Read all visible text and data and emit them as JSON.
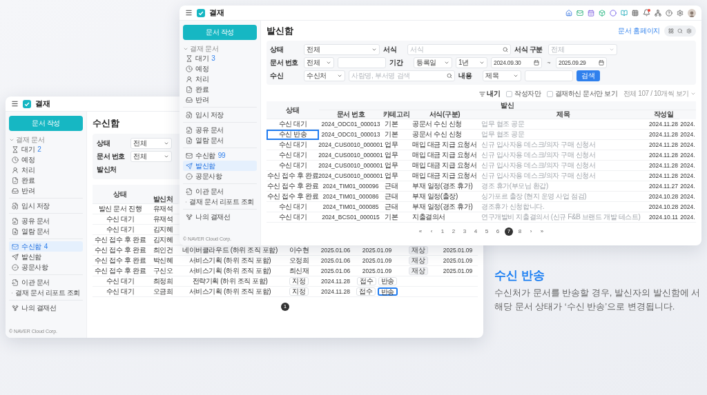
{
  "back_window": {
    "app_name": "결재",
    "sidebar": {
      "compose_button": "문서 작성",
      "section": {
        "label": "결재 문서",
        "expanded": true,
        "items": [
          {
            "label": "대기",
            "count": "2",
            "selected": false
          },
          {
            "label": "예정",
            "selected": false
          },
          {
            "label": "처리",
            "selected": false
          },
          {
            "label": "완료",
            "selected": false
          },
          {
            "label": "반려",
            "selected": false
          }
        ]
      },
      "groups": [
        [
          {
            "label": "임시 저장",
            "selected": false
          }
        ],
        [
          {
            "label": "공유 문서",
            "selected": false
          },
          {
            "label": "열람 문서",
            "selected": false
          }
        ],
        [
          {
            "label": "수신함",
            "count": "4",
            "selected": true
          },
          {
            "label": "발신함",
            "selected": false
          },
          {
            "label": "공문사항",
            "selected": false
          }
        ],
        [
          {
            "label": "이관 문서",
            "selected": false
          },
          {
            "label": "결재 문서 리포트 조회",
            "selected": false
          }
        ],
        [
          {
            "label": "나의 결재선",
            "selected": false
          }
        ]
      ],
      "footer": "© NAVER Cloud Corp."
    },
    "title": "수신함",
    "filters": [
      [
        {
          "kind": "label",
          "text": "상태"
        },
        {
          "kind": "select",
          "value": "전체",
          "disabled": false
        }
      ],
      [
        {
          "kind": "label",
          "text": "문서 번호"
        },
        {
          "kind": "select",
          "value": "전체",
          "disabled": false
        }
      ],
      [
        {
          "kind": "label",
          "text": "발신처"
        }
      ]
    ],
    "table": {
      "columns": [
        "상태",
        "발신처"
      ],
      "rows": [
        [
          {
            "kind": "text",
            "text": "발신 문서 진행"
          },
          {
            "kind": "text",
            "text": "유재석"
          }
        ],
        [
          {
            "kind": "text",
            "text": "수신 대기"
          },
          {
            "kind": "text",
            "text": "유재석"
          }
        ],
        [
          {
            "kind": "text",
            "text": "수신 대기"
          },
          {
            "kind": "text",
            "text": "김지혜"
          }
        ],
        [
          {
            "kind": "text",
            "text": "수신 접수 후 완료"
          },
          {
            "kind": "text",
            "text": "김지혜"
          }
        ],
        [
          {
            "kind": "text",
            "text": "수신 접수 후 완료"
          },
          {
            "kind": "text",
            "text": "최인건"
          },
          {
            "kind": "text",
            "text": "네이버클라우드 (하위 조직 포함)"
          },
          {
            "kind": "text",
            "text": "이수현"
          },
          {
            "kind": "text",
            "text": "2025.01.06"
          },
          {
            "kind": "text",
            "text": "2025.01.09"
          },
          {
            "kind": "badge",
            "text": "재상"
          },
          {
            "kind": "text",
            "text": "2025.01.09"
          }
        ],
        [
          {
            "kind": "text",
            "text": "수신 접수 후 완료"
          },
          {
            "kind": "text",
            "text": "박신혜"
          },
          {
            "kind": "text",
            "text": "서비스기획 (하위 조직 포함)"
          },
          {
            "kind": "text",
            "text": "오정희"
          },
          {
            "kind": "text",
            "text": "2025.01.06"
          },
          {
            "kind": "text",
            "text": "2025.01.09"
          },
          {
            "kind": "badge",
            "text": "재상"
          },
          {
            "kind": "text",
            "text": "2025.01.09"
          }
        ],
        [
          {
            "kind": "text",
            "text": "수신 접수 후 완료"
          },
          {
            "kind": "text",
            "text": "구신오"
          },
          {
            "kind": "text",
            "text": "서비스기획 (하위 조직 포함)"
          },
          {
            "kind": "text",
            "text": "최신재"
          },
          {
            "kind": "text",
            "text": "2025.01.06"
          },
          {
            "kind": "text",
            "text": "2025.01.09"
          },
          {
            "kind": "badge",
            "text": "재상"
          },
          {
            "kind": "text",
            "text": "2025.01.09"
          }
        ],
        [
          {
            "kind": "text",
            "text": "수신 대기"
          },
          {
            "kind": "text",
            "text": "최정희"
          },
          {
            "kind": "text",
            "text": "전략기획 (하위 조직 포함)"
          },
          {
            "kind": "buttons",
            "buttons": [
              {
                "label": "지정",
                "highlighted": false
              }
            ]
          },
          {
            "kind": "text",
            "text": "2024.11.28"
          },
          {
            "kind": "buttons",
            "buttons": [
              {
                "label": "접수",
                "highlighted": false
              },
              {
                "label": "반송",
                "highlighted": false
              }
            ]
          }
        ],
        [
          {
            "kind": "text",
            "text": "수신 대기"
          },
          {
            "kind": "text",
            "text": "오금희"
          },
          {
            "kind": "text",
            "text": "서비스기획 (하위 조직 포함)"
          },
          {
            "kind": "buttons",
            "buttons": [
              {
                "label": "지정",
                "highlighted": false
              }
            ]
          },
          {
            "kind": "text",
            "text": "2024.11.28"
          },
          {
            "kind": "buttons",
            "buttons": [
              {
                "label": "접수",
                "highlighted": false
              },
              {
                "label": "반송",
                "highlighted": true
              }
            ]
          }
        ]
      ]
    },
    "pagination": [
      {
        "label": "1",
        "selected": true
      }
    ]
  },
  "front_window": {
    "app_name": "결재",
    "unread_notifications": true,
    "sidebar": {
      "compose_button": "문서 작성",
      "section": {
        "label": "결재 문서",
        "expanded": true,
        "items": [
          {
            "label": "대기",
            "count": "3",
            "selected": false
          },
          {
            "label": "예정",
            "selected": false
          },
          {
            "label": "처리",
            "selected": false
          },
          {
            "label": "완료",
            "selected": false
          },
          {
            "label": "반려",
            "selected": false
          }
        ]
      },
      "groups": [
        [
          {
            "label": "임시 저장",
            "selected": false
          }
        ],
        [
          {
            "label": "공유 문서",
            "selected": false
          },
          {
            "label": "열람 문서",
            "selected": false
          }
        ],
        [
          {
            "label": "수신함",
            "count": "99",
            "selected": false
          },
          {
            "label": "발신함",
            "selected": true
          },
          {
            "label": "공문사항",
            "selected": false
          }
        ],
        [
          {
            "label": "이관 문서",
            "selected": false
          },
          {
            "label": "결재 문서 리포트 조회",
            "selected": false
          }
        ],
        [
          {
            "label": "나의 결재선",
            "selected": false
          }
        ]
      ],
      "footer": "© NAVER Cloud Corp."
    },
    "title": "발신함",
    "homepage_link": "문서 홈페이지",
    "filters": [
      [
        {
          "kind": "label",
          "text": "상태"
        },
        {
          "kind": "select",
          "value": "전체",
          "disabled": false
        },
        {
          "kind": "label",
          "text": "서식"
        },
        {
          "kind": "search",
          "placeholder": "서식"
        },
        {
          "kind": "label",
          "text": "서식 구분"
        },
        {
          "kind": "select",
          "value": "전체",
          "disabled": true
        }
      ],
      [
        {
          "kind": "label",
          "text": "문서 번호"
        },
        {
          "kind": "select",
          "value": "전체",
          "disabled": false
        },
        {
          "kind": "input"
        },
        {
          "kind": "label",
          "text": "기간"
        },
        {
          "kind": "select",
          "value": "등록일",
          "disabled": false
        },
        {
          "kind": "select",
          "value": "1년",
          "disabled": false
        },
        {
          "kind": "date",
          "value": "2024.09.30"
        },
        {
          "kind": "separator",
          "text": "~"
        },
        {
          "kind": "date",
          "value": "2025.09.29"
        }
      ],
      [
        {
          "kind": "label",
          "text": "수신"
        },
        {
          "kind": "select",
          "value": "수신처",
          "disabled": false
        },
        {
          "kind": "search",
          "placeholder": "사람명, 부서명 검색"
        },
        {
          "kind": "label",
          "text": "내용"
        },
        {
          "kind": "select",
          "value": "제목",
          "disabled": false
        },
        {
          "kind": "input"
        },
        {
          "kind": "button",
          "text": "검색"
        }
      ]
    ],
    "toolbar": {
      "filter_button": "내기",
      "checkboxes": [
        {
          "label": "작성자만",
          "checked": false
        },
        {
          "label": "결재하신 문서만 보기",
          "checked": false
        }
      ],
      "page_size": "전체 107 / 10개씩 보기"
    },
    "table": {
      "status_header": "상태",
      "group_header": "발신",
      "columns": [
        "문서 번호",
        "카테고리",
        "서식(구분)",
        "제목",
        "작성일"
      ],
      "rows": [
        {
          "status": "수신 대기",
          "highlighted": false,
          "doc_no": "2024_ODC01_000013",
          "category": "기본",
          "form": "공문서 수신 신청",
          "title": "업무 협조 공문",
          "created": "2024.11.28",
          "column_7": "2024."
        },
        {
          "status": "수신 반송",
          "highlighted": true,
          "doc_no": "2024_ODC01_000013",
          "category": "기본",
          "form": "공문서 수신 신청",
          "title": "업무 협조 공문",
          "created": "2024.11.28",
          "column_7": "2024."
        },
        {
          "status": "수신 대기",
          "highlighted": false,
          "doc_no": "2024_CUS0010_000001",
          "category": "업무",
          "form": "매입 대금 지급 요청서",
          "title": "신규 입사자용 데스크/의자 구매 신청서",
          "created": "2024.11.28",
          "column_7": "2024."
        },
        {
          "status": "수신 대기",
          "highlighted": false,
          "doc_no": "2024_CUS0010_000001",
          "category": "업무",
          "form": "매입 대금 지급 요청서",
          "title": "신규 입사자용 데스크/의자 구매 신청서",
          "created": "2024.11.28",
          "column_7": "2024."
        },
        {
          "status": "수신 대기",
          "highlighted": false,
          "doc_no": "2024_CUS0010_000001",
          "category": "업무",
          "form": "매입 대금 지급 요청서",
          "title": "신규 입사자용 데스크/의자 구매 신청서",
          "created": "2024.11.28",
          "column_7": "2024."
        },
        {
          "status": "수신 접수 후 완료",
          "highlighted": false,
          "doc_no": "2024_CUS0010_000001",
          "category": "업무",
          "form": "매입 대금 지급 요청서",
          "title": "신규 입사자용 데스크/의자 구매 신청서",
          "created": "2024.11.28",
          "column_7": "2024."
        },
        {
          "status": "수신 접수 후 완료",
          "highlighted": false,
          "doc_no": "2024_TIM01_000096",
          "category": "근태",
          "form": "부재 일정(경조 휴가)",
          "title": "경조 휴가(부모님 환갑)",
          "created": "2024.11.27",
          "column_7": "2024."
        },
        {
          "status": "수신 접수 후 완료",
          "highlighted": false,
          "doc_no": "2024_TIM01_000086",
          "category": "근태",
          "form": "부재 일정(출장)",
          "title": "싱가포르 출장 (현지 운영 사업 점검)",
          "created": "2024.10.28",
          "column_7": "2024."
        },
        {
          "status": "수신 대기",
          "highlighted": false,
          "doc_no": "2024_TIM01_000085",
          "category": "근태",
          "form": "부재 일정(경조 휴가)",
          "title": "경조휴가 신청합니다.",
          "created": "2024.10.28",
          "column_7": "2024."
        },
        {
          "status": "수신 대기",
          "highlighted": false,
          "doc_no": "2024_BCS01_000015",
          "category": "기본",
          "form": "지출결의서",
          "title": "연구개발비 지출결의서 (신규 F&B 브랜드 개발 테스트)",
          "created": "2024.10.11",
          "column_7": "2024."
        }
      ]
    },
    "pagination": [
      {
        "label": "«",
        "selected": false
      },
      {
        "label": "‹",
        "selected": false
      },
      {
        "label": "1",
        "selected": false
      },
      {
        "label": "2",
        "selected": false
      },
      {
        "label": "3",
        "selected": false
      },
      {
        "label": "4",
        "selected": false
      },
      {
        "label": "5",
        "selected": false
      },
      {
        "label": "6",
        "selected": false
      },
      {
        "label": "7",
        "selected": true
      },
      {
        "label": "8",
        "selected": false
      },
      {
        "label": "›",
        "selected": false
      },
      {
        "label": "»",
        "selected": false
      }
    ]
  },
  "caption": {
    "title": "수신 반송",
    "text": "수신처가 문서를 반송할 경우, 발신자의 발신함에 서 해당 문서 상태가 ‘수신 반송’으로 변경됩니다."
  }
}
